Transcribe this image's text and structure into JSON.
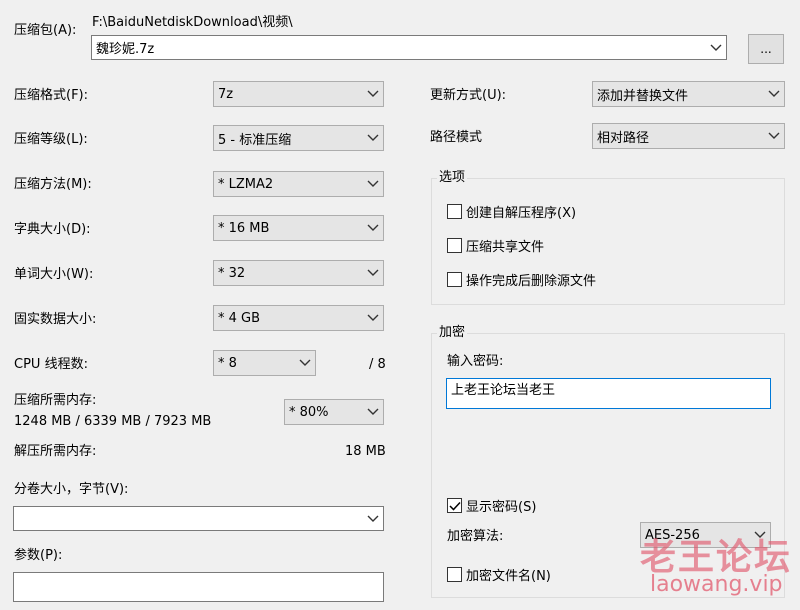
{
  "archive": {
    "label": "压缩包(A):",
    "path": "F:\\BaiduNetdiskDownload\\视频\\",
    "filename": "魏珍妮.7z",
    "browse_label": "..."
  },
  "left": {
    "format": {
      "label": "压缩格式(F):",
      "value": "7z"
    },
    "level": {
      "label": "压缩等级(L):",
      "value": "5 - 标准压缩"
    },
    "method": {
      "label": "压缩方法(M):",
      "value": "* LZMA2"
    },
    "dict": {
      "label": "字典大小(D):",
      "value": "* 16 MB"
    },
    "word": {
      "label": "单词大小(W):",
      "value": "* 32"
    },
    "solid": {
      "label": "固实数据大小:",
      "value": "* 4 GB"
    },
    "threads": {
      "label": "CPU 线程数:",
      "value": "* 8",
      "max": "/ 8"
    },
    "mem": {
      "label": "压缩所需内存:",
      "detail": "1248 MB / 6339 MB / 7923 MB",
      "value": "* 80%"
    },
    "decomp": {
      "label": "解压所需内存:",
      "value": "18 MB"
    },
    "volume": {
      "label": "分卷大小，字节(V):",
      "value": ""
    },
    "params": {
      "label": "参数(P):",
      "value": ""
    }
  },
  "right": {
    "update": {
      "label": "更新方式(U):",
      "value": "添加并替换文件"
    },
    "pathmode": {
      "label": "路径模式",
      "value": "相对路径"
    },
    "options": {
      "title": "选项",
      "items": [
        "创建自解压程序(X)",
        "压缩共享文件",
        "操作完成后删除源文件"
      ]
    },
    "encryption": {
      "title": "加密",
      "password_label": "输入密码:",
      "password": "上老王论坛当老王",
      "show_password": "显示密码(S)",
      "algo_label": "加密算法:",
      "algo": "AES-256",
      "encrypt_names": "加密文件名(N)"
    }
  },
  "watermark": {
    "line1": "老王论坛",
    "line2": "laowang.vip"
  }
}
